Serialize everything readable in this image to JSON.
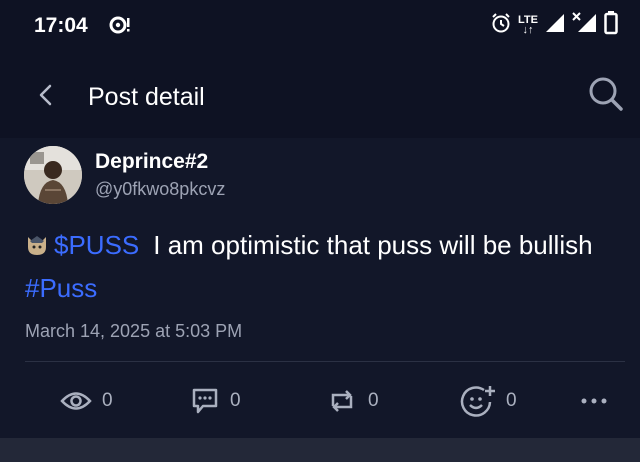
{
  "status_bar": {
    "time": "17:04",
    "network": "LTE"
  },
  "header": {
    "title": "Post detail"
  },
  "post": {
    "author": {
      "name": "Deprince#2",
      "handle": "@y0fkwo8pkcvz"
    },
    "text": {
      "ticker": "$PUSS",
      "body": "I am optimistic that puss will be bullish",
      "hashtag": "#Puss"
    },
    "timestamp": "March 14, 2025 at 5:03 PM",
    "actions": {
      "views": "0",
      "comments": "0",
      "reposts": "0",
      "reactions": "0"
    }
  },
  "colors": {
    "background": "#0d1122",
    "link": "#3b6cff",
    "muted": "#9da3b4"
  }
}
